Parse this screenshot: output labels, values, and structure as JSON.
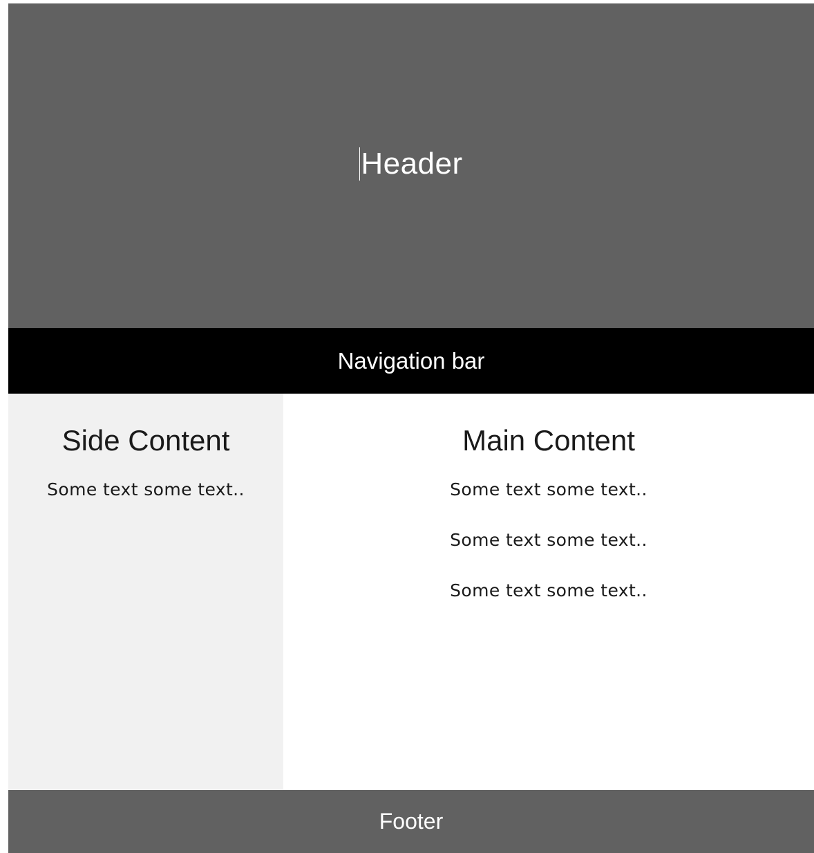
{
  "header": {
    "title": "Header"
  },
  "navbar": {
    "label": "Navigation bar"
  },
  "side": {
    "title": "Side Content",
    "paragraphs": [
      "Some text some text.."
    ]
  },
  "main": {
    "title": "Main Content",
    "paragraphs": [
      "Some text some text..",
      "Some text some text..",
      "Some text some text.."
    ]
  },
  "footer": {
    "label": "Footer"
  },
  "colors": {
    "header_bg": "#616161",
    "navbar_bg": "#000000",
    "side_bg": "#f1f1f1",
    "main_bg": "#ffffff",
    "footer_bg": "#616161"
  }
}
